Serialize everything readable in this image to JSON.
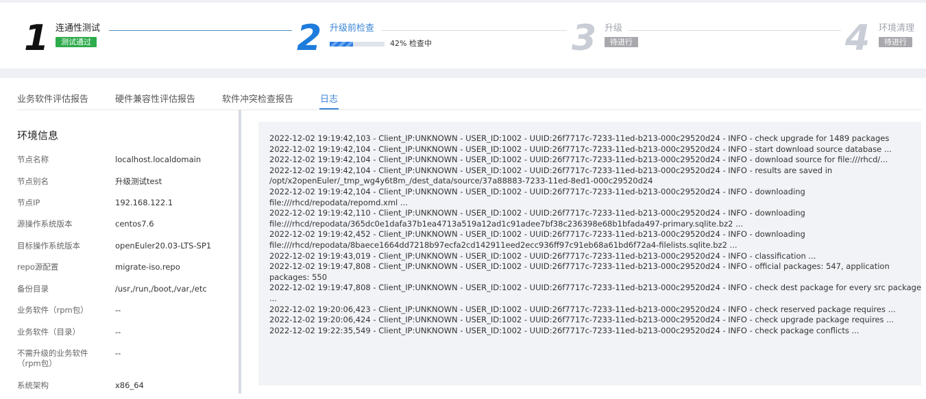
{
  "steps": [
    {
      "number": "1",
      "title": "连通性测试",
      "badge": "测试通过"
    },
    {
      "number": "2",
      "title": "升级前检查",
      "progress_percent": 42,
      "progress_text": "42% 检查中"
    },
    {
      "number": "3",
      "title": "升级",
      "badge": "待进行"
    },
    {
      "number": "4",
      "title": "环境清理",
      "badge": "待进行"
    }
  ],
  "colors": {
    "accent": "#3a84d6",
    "step_active": "#1d7cdc",
    "step_done": "#111111",
    "step_pending": "#c9cdd6",
    "success": "#2eab4b",
    "pending": "#a8a8ad"
  },
  "tabs": [
    {
      "label": "业务软件评估报告"
    },
    {
      "label": "硬件兼容性评估报告"
    },
    {
      "label": "软件冲突检查报告"
    },
    {
      "label": "日志",
      "active": true
    }
  ],
  "env": {
    "title": "环境信息",
    "rows": [
      {
        "label": "节点名称",
        "value": "localhost.localdomain"
      },
      {
        "label": "节点别名",
        "value": "升级测试test"
      },
      {
        "label": "节点IP",
        "value": "192.168.122.1"
      },
      {
        "label": "源操作系统版本",
        "value": "centos7.6"
      },
      {
        "label": "目标操作系统版本",
        "value": "openEuler20.03-LTS-SP1"
      },
      {
        "label": "repo源配置",
        "value": "migrate-iso.repo"
      },
      {
        "label": "备份目录",
        "value": "/usr,/run,/boot,/var,/etc"
      },
      {
        "label": "业务软件（rpm包）",
        "value": "--"
      },
      {
        "label": "业务软件（目录）",
        "value": "--"
      },
      {
        "label": "不需升级的业务软件",
        "label2": "（rpm包）",
        "value": "--"
      },
      {
        "label": "系统架构",
        "value": "x86_64"
      }
    ]
  },
  "log": {
    "lines": [
      "2022-12-02 19:19:42,103 - Client_IP:UNKNOWN - USER_ID:1002 - UUID:26f7717c-7233-11ed-b213-000c29520d24 - INFO - check upgrade for 1489 packages",
      "2022-12-02 19:19:42,104 - Client_IP:UNKNOWN - USER_ID:1002 - UUID:26f7717c-7233-11ed-b213-000c29520d24 - INFO - start download source database ...",
      "2022-12-02 19:19:42,104 - Client_IP:UNKNOWN - USER_ID:1002 - UUID:26f7717c-7233-11ed-b213-000c29520d24 - INFO - download source for file:///rhcd/...",
      "2022-12-02 19:19:42,104 - Client_IP:UNKNOWN - USER_ID:1002 - UUID:26f7717c-7233-11ed-b213-000c29520d24 - INFO - results are saved in",
      "/opt/x2openEuler/_tmp_wg4y6t8m_/dest_data/source/37a88883-7233-11ed-8ed1-000c29520d24",
      "2022-12-02 19:19:42,104 - Client_IP:UNKNOWN - USER_ID:1002 - UUID:26f7717c-7233-11ed-b213-000c29520d24 - INFO - downloading",
      "file:///rhcd/repodata/repomd.xml ...",
      "2022-12-02 19:19:42,110 - Client_IP:UNKNOWN - USER_ID:1002 - UUID:26f7717c-7233-11ed-b213-000c29520d24 - INFO - downloading",
      "file:///rhcd/repodata/365dc0e1dafa37b1ea4713a519a12ad1c91adee7bf38c236398e68b1bfada497-primary.sqlite.bz2 ...",
      "2022-12-02 19:19:42,452 - Client_IP:UNKNOWN - USER_ID:1002 - UUID:26f7717c-7233-11ed-b213-000c29520d24 - INFO - downloading",
      "file:///rhcd/repodata/8baece1664dd7218b97ecfa2cd142911eed2ecc936ff97c91eb68a61bd6f72a4-filelists.sqlite.bz2 ...",
      "2022-12-02 19:19:43,019 - Client_IP:UNKNOWN - USER_ID:1002 - UUID:26f7717c-7233-11ed-b213-000c29520d24 - INFO - classification ...",
      "2022-12-02 19:19:47,808 - Client_IP:UNKNOWN - USER_ID:1002 - UUID:26f7717c-7233-11ed-b213-000c29520d24 - INFO - official packages: 547, application",
      "packages: 550",
      "2022-12-02 19:19:47,808 - Client_IP:UNKNOWN - USER_ID:1002 - UUID:26f7717c-7233-11ed-b213-000c29520d24 - INFO - check dest package for every src package",
      "...",
      "2022-12-02 19:20:06,423 - Client_IP:UNKNOWN - USER_ID:1002 - UUID:26f7717c-7233-11ed-b213-000c29520d24 - INFO - check reserved package requires ...",
      "2022-12-02 19:20:06,424 - Client_IP:UNKNOWN - USER_ID:1002 - UUID:26f7717c-7233-11ed-b213-000c29520d24 - INFO - check upgrade package requires ...",
      "2022-12-02 19:22:35,549 - Client_IP:UNKNOWN - USER_ID:1002 - UUID:26f7717c-7233-11ed-b213-000c29520d24 - INFO - check package conflicts ..."
    ]
  }
}
